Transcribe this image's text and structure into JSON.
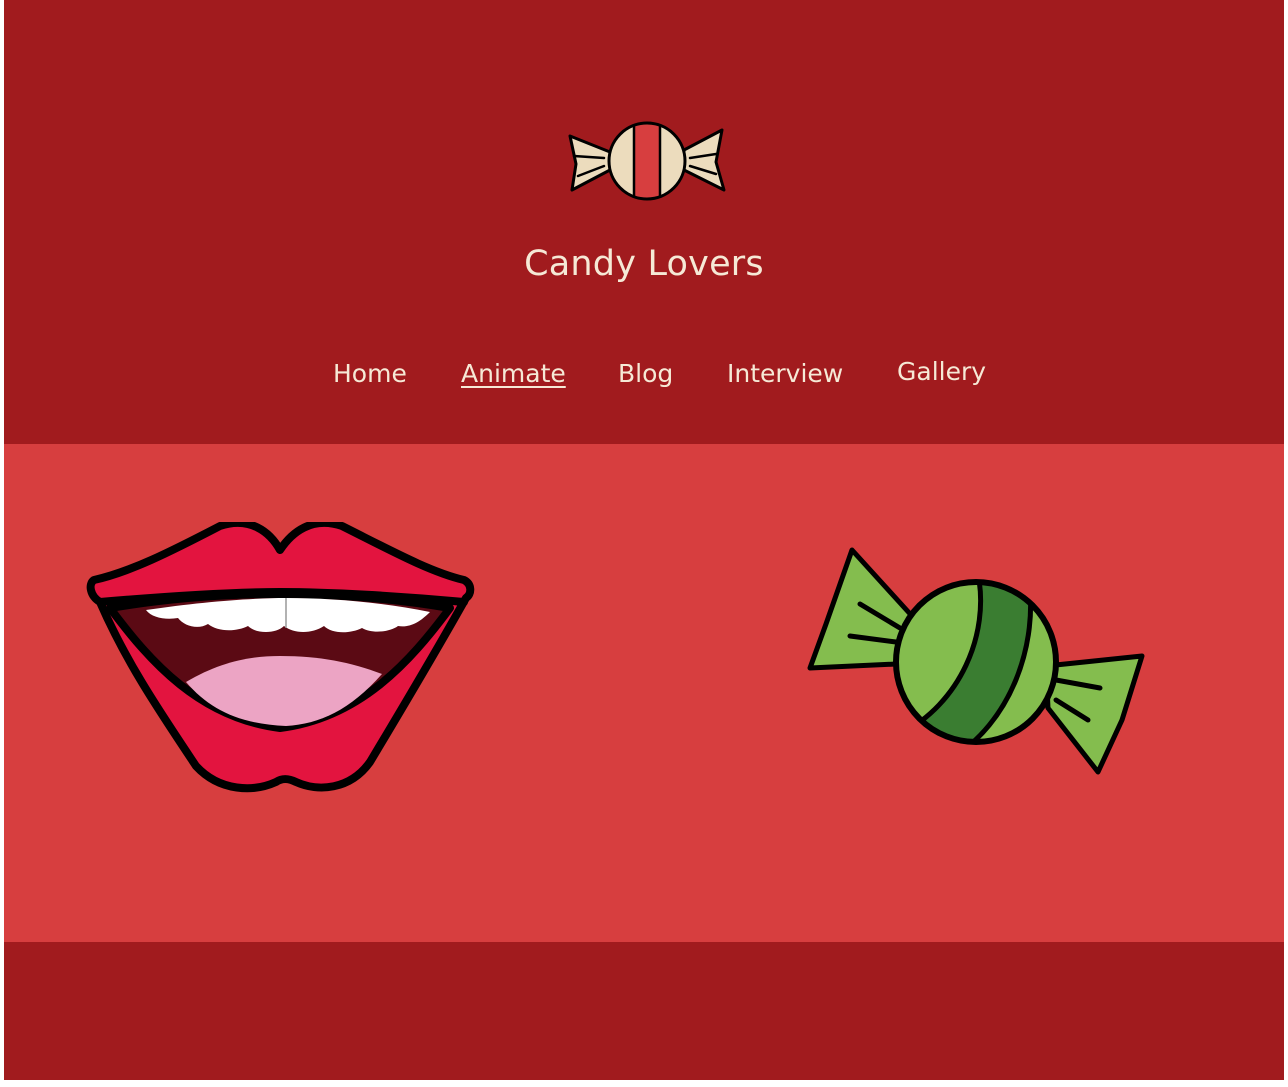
{
  "header": {
    "site_title": "Candy Lovers",
    "logo_icon": "striped-candy-icon"
  },
  "nav": {
    "items": [
      {
        "label": "Home",
        "active": false
      },
      {
        "label": "Animate",
        "active": true
      },
      {
        "label": "Blog",
        "active": false
      },
      {
        "label": "Interview",
        "active": false
      },
      {
        "label": "Gallery",
        "active": false
      }
    ]
  },
  "hero": {
    "images": [
      {
        "icon": "open-mouth-lips-icon"
      },
      {
        "icon": "green-wrapped-candy-icon"
      }
    ]
  },
  "colors": {
    "header_bg": "#a11b1e",
    "hero_bg": "#d73e3f",
    "text": "#f6e9d6",
    "lip_red": "#e3143f",
    "candy_light_green": "#84bd4e",
    "candy_dark_green": "#3a7d31",
    "logo_cream": "#ecdcbd",
    "logo_stripe": "#d73e3f"
  }
}
